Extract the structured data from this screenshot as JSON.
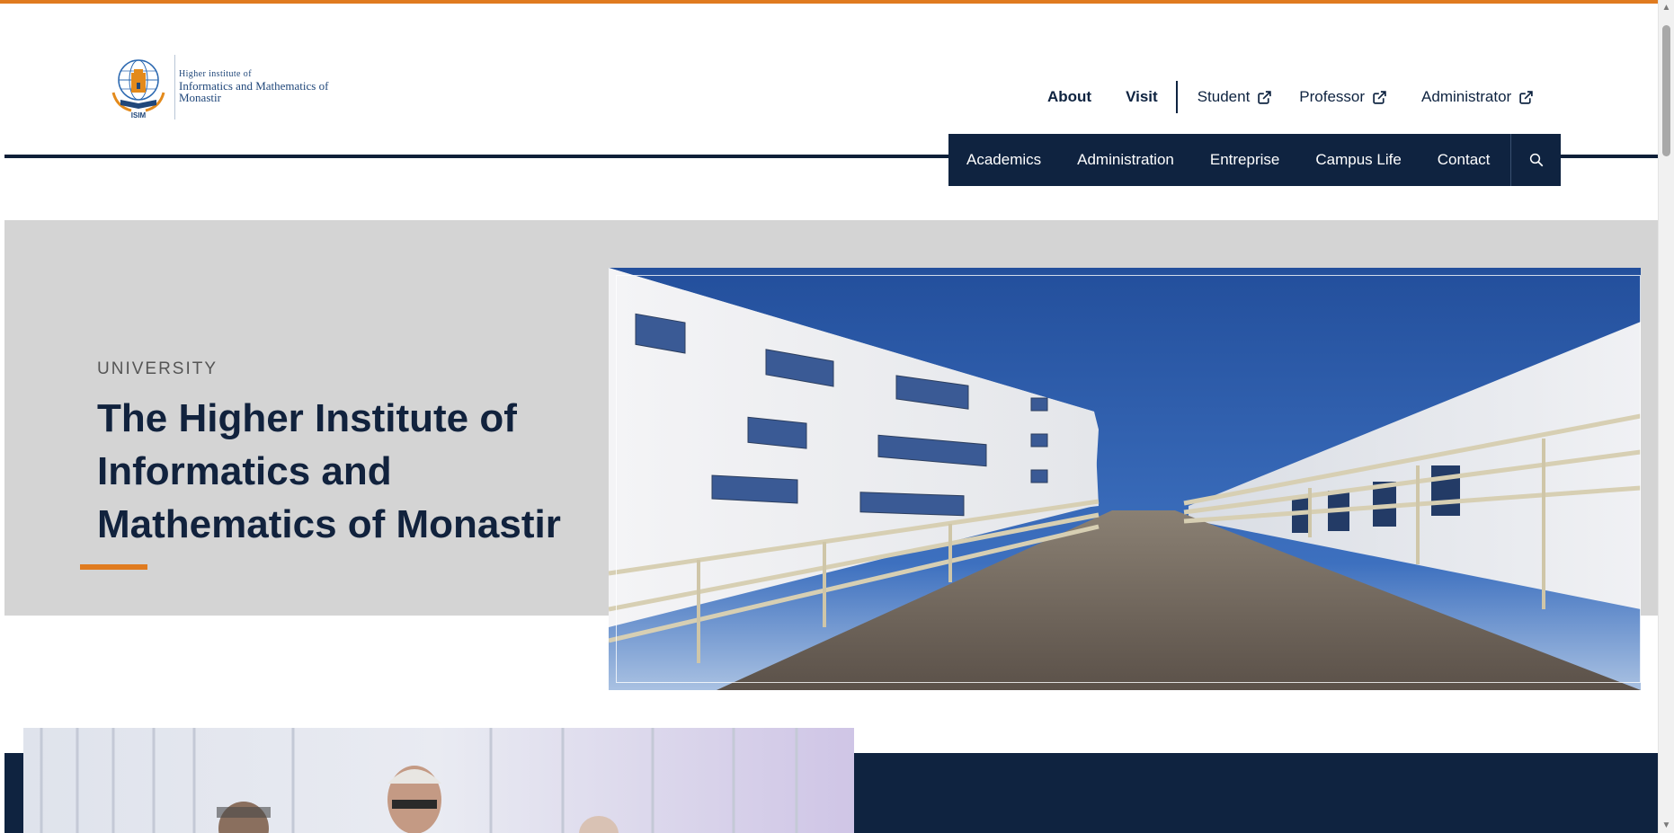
{
  "header": {
    "logo": {
      "emblem_text": "ISIM",
      "line1": "Higher institute of",
      "line2": "Informatics and Mathematics of",
      "line3": "Monastir"
    },
    "top_links": {
      "about": "About",
      "visit": "Visit",
      "student": "Student",
      "professor": "Professor",
      "administrator": "Administrator"
    },
    "nav": {
      "items": [
        "Academics",
        "Administration",
        "Entreprise",
        "Campus Life",
        "Contact"
      ],
      "search_icon": "search-icon"
    }
  },
  "hero": {
    "eyebrow": "UNIVERSITY",
    "title": "The Higher Institute of Informatics and Mathematics of Monastir",
    "photo": "campus-building-walkway"
  },
  "section2": {
    "photo": "event-people-photo"
  },
  "colors": {
    "accent": "#e07b1f",
    "navy": "#0f2340",
    "hero_bg": "#d4d4d4"
  }
}
